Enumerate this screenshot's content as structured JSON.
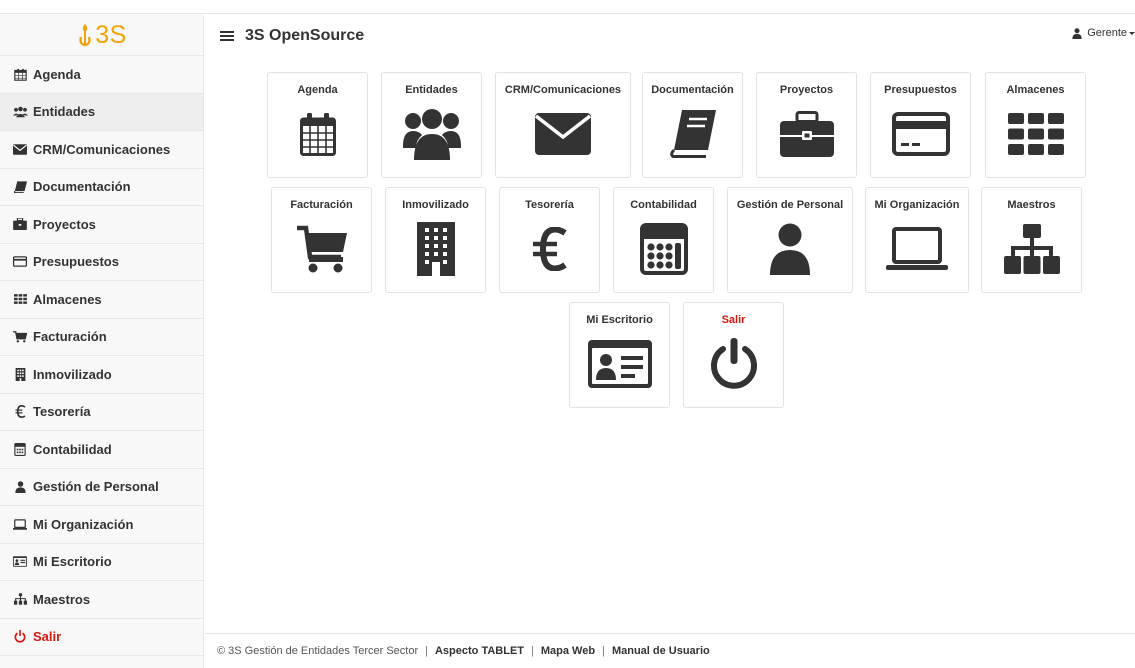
{
  "app": {
    "logo_text": "3S",
    "title": "3S OpenSource",
    "user": "Gerente"
  },
  "colors": {
    "logo": "#f0a30a",
    "icon": "#333333",
    "salir": "#d9170f"
  },
  "sidebar": {
    "items": [
      {
        "label": "Agenda",
        "icon": "calendar-icon"
      },
      {
        "label": "Entidades",
        "icon": "users-icon"
      },
      {
        "label": "CRM/Comunicaciones",
        "icon": "envelope-icon"
      },
      {
        "label": "Documentación",
        "icon": "book-icon"
      },
      {
        "label": "Proyectos",
        "icon": "briefcase-icon"
      },
      {
        "label": "Presupuestos",
        "icon": "credit-card-icon"
      },
      {
        "label": "Almacenes",
        "icon": "grid-icon"
      },
      {
        "label": "Facturación",
        "icon": "cart-icon"
      },
      {
        "label": "Inmovilizado",
        "icon": "building-icon"
      },
      {
        "label": "Tesorería",
        "icon": "euro-icon"
      },
      {
        "label": "Contabilidad",
        "icon": "calculator-icon"
      },
      {
        "label": "Gestión de Personal",
        "icon": "user-icon"
      },
      {
        "label": "Mi Organización",
        "icon": "laptop-icon"
      },
      {
        "label": "Mi Escritorio",
        "icon": "id-card-icon"
      },
      {
        "label": "Maestros",
        "icon": "sitemap-icon"
      },
      {
        "label": "Salir",
        "icon": "power-icon"
      }
    ]
  },
  "tiles": {
    "row1": [
      {
        "label": "Agenda",
        "icon": "calendar-icon"
      },
      {
        "label": "Entidades",
        "icon": "users-icon"
      },
      {
        "label": "CRM/Comunicaciones",
        "icon": "envelope-icon"
      },
      {
        "label": "Documentación",
        "icon": "book-icon"
      },
      {
        "label": "Proyectos",
        "icon": "briefcase-icon"
      },
      {
        "label": "Presupuestos",
        "icon": "credit-card-icon"
      },
      {
        "label": "Almacenes",
        "icon": "grid-icon"
      }
    ],
    "row2": [
      {
        "label": "Facturación",
        "icon": "cart-icon"
      },
      {
        "label": "Inmovilizado",
        "icon": "building-icon"
      },
      {
        "label": "Tesorería",
        "icon": "euro-icon"
      },
      {
        "label": "Contabilidad",
        "icon": "calculator-icon"
      },
      {
        "label": "Gestión de Personal",
        "icon": "user-icon"
      },
      {
        "label": "Mi Organización",
        "icon": "laptop-icon"
      },
      {
        "label": "Maestros",
        "icon": "sitemap-icon"
      }
    ],
    "row3": [
      {
        "label": "Mi Escritorio",
        "icon": "id-card-icon"
      },
      {
        "label": "Salir",
        "icon": "power-icon"
      }
    ]
  },
  "footer": {
    "copyright": "© 3S Gestión de Entidades Tercer Sector",
    "links": [
      "Aspecto TABLET",
      "Mapa Web",
      "Manual de Usuario"
    ]
  }
}
